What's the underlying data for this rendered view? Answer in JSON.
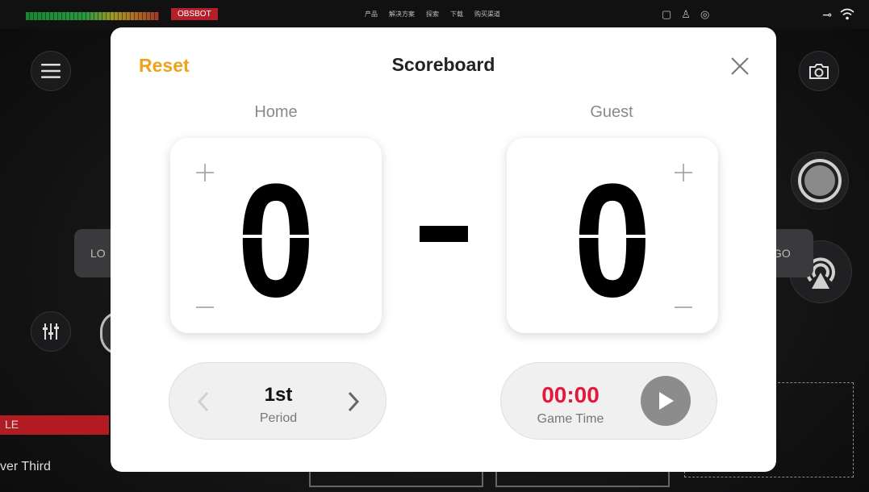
{
  "background": {
    "brand_label": "OBSBOT",
    "web_nav": [
      "产品",
      "解决方案",
      "探索",
      "下载",
      "购买渠道"
    ],
    "logo_tab_left": "LO",
    "logo_tab_right": "GO",
    "red_bar_label": "LE",
    "lower_third_label": "ver Third"
  },
  "modal": {
    "reset_label": "Reset",
    "title": "Scoreboard",
    "home": {
      "label": "Home",
      "score": "0"
    },
    "guest": {
      "label": "Guest",
      "score": "0"
    },
    "period": {
      "value": "1st",
      "label": "Period"
    },
    "game_time": {
      "value": "00:00",
      "label": "Game Time"
    }
  },
  "icons": {
    "menu": "hamburger-icon",
    "camera": "camera-icon",
    "record": "record-icon",
    "live": "live-broadcast-icon",
    "mixer": "mixer-icon",
    "close": "close-icon",
    "plus": "plus-icon",
    "minus": "minus-icon",
    "chevron_left": "chevron-left-icon",
    "chevron_right": "chevron-right-icon",
    "play": "play-icon"
  },
  "colors": {
    "accent": "#f0a21c",
    "timer": "#e4173c",
    "brand": "#b4202a"
  }
}
